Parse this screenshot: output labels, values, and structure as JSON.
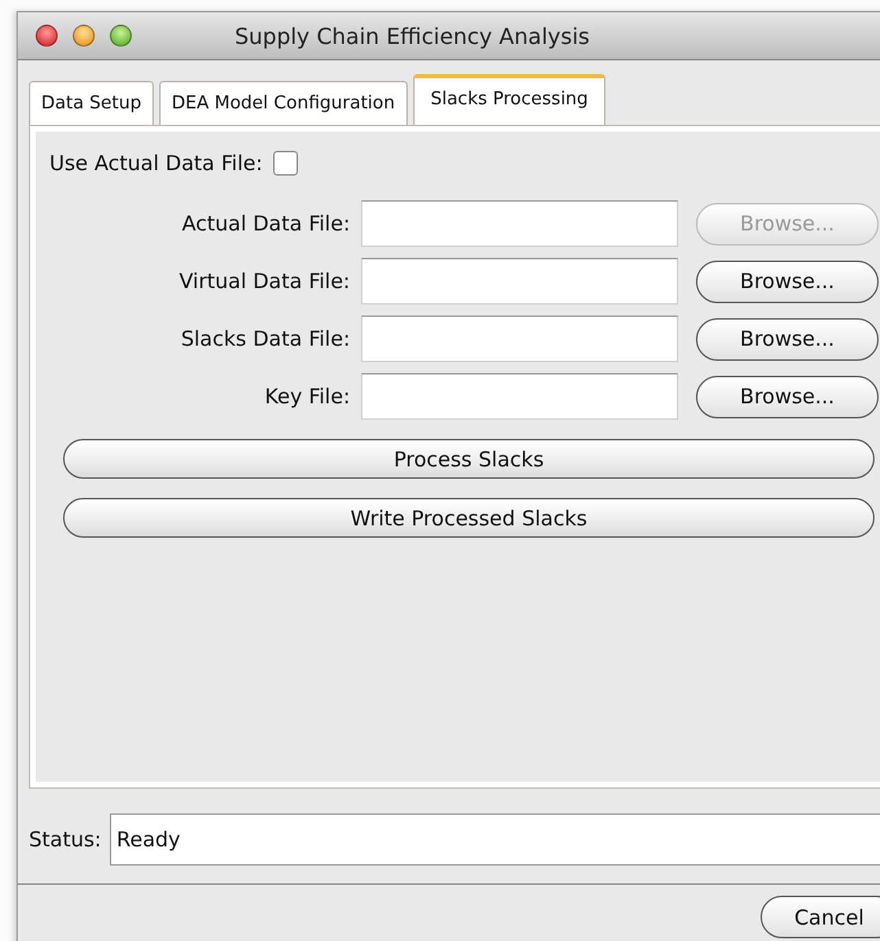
{
  "window": {
    "title": "Supply Chain Efficiency Analysis"
  },
  "tabs": [
    {
      "label": "Data Setup",
      "selected": false
    },
    {
      "label": "DEA Model Configuration",
      "selected": false
    },
    {
      "label": "Slacks Processing",
      "selected": true
    }
  ],
  "use_actual": {
    "label": "Use Actual Data File:",
    "checked": false
  },
  "files": [
    {
      "label": "Actual Data File:",
      "button": "Browse...",
      "disabled": true
    },
    {
      "label": "Virtual Data File:",
      "button": "Browse...",
      "disabled": false
    },
    {
      "label": "Slacks Data File:",
      "button": "Browse...",
      "disabled": false
    },
    {
      "label": "Key File:",
      "button": "Browse...",
      "disabled": false
    }
  ],
  "actions": [
    "Process Slacks",
    "Write Processed Slacks"
  ],
  "status": {
    "label": "Status:",
    "value": "Ready"
  },
  "buttons": [
    "Cancel"
  ]
}
